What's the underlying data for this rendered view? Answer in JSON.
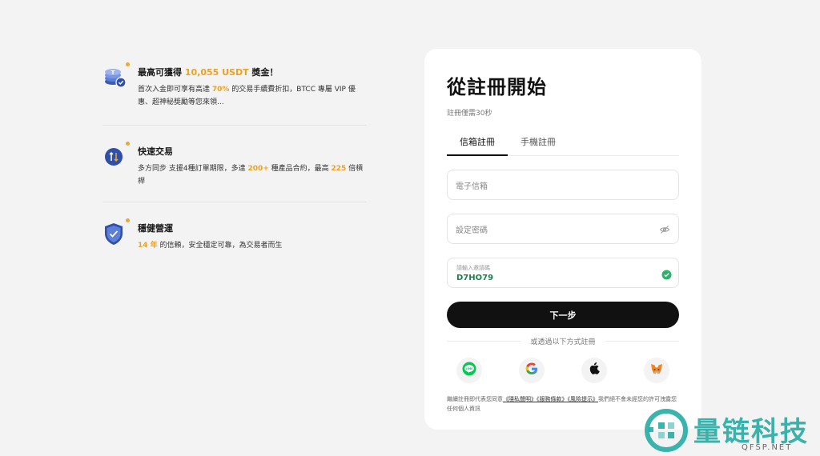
{
  "benefits": [
    {
      "icon": "usdt-coins-icon",
      "title_prefix": "最高可獲得 ",
      "title_highlight": "10,055 USDT",
      "title_suffix": " 獎金！",
      "desc_1": "首次入金即可享有高達 ",
      "desc_hl_1": "70%",
      "desc_2": " 的交易手續費折扣，BTCC 專屬 VIP 優惠、超神秘獎勵等您來領..."
    },
    {
      "icon": "fast-trade-icon",
      "title": "快速交易",
      "desc_1": "多方同步 支援4種訂單期限，多達 ",
      "desc_hl_1": "200+",
      "desc_2": " 種產品合約，最高 ",
      "desc_hl_2": "225",
      "desc_3": " 倍槓桿"
    },
    {
      "icon": "shield-check-icon",
      "title": "穩健營運",
      "desc_hl_1": "14 年",
      "desc_2": " 的信賴，安全穩定可靠，為交易者而生"
    }
  ],
  "card": {
    "title": "從註冊開始",
    "subtitle": "註冊僅需30秒",
    "tabs": [
      "信箱註冊",
      "手機註冊"
    ],
    "email_placeholder": "電子信箱",
    "password_placeholder": "設定密碼",
    "invite_label": "請輸入邀請碼",
    "invite_code": "D7HO79",
    "next_button": "下一步",
    "divider_text": "或透過以下方式註冊",
    "socials": [
      "line-icon",
      "google-icon",
      "apple-icon",
      "metamask-icon"
    ],
    "terms_prefix": "繼續註冊即代表您同意",
    "terms_link_1": "《隱私聲明》",
    "terms_link_2": "《服務條款》",
    "terms_link_3": "《風險提示》",
    "terms_suffix": "我們絕不會未經您的許可洩露您任何個人資訊"
  },
  "watermark": {
    "text": "量链科技",
    "sub": "QFSP.NET"
  },
  "colors": {
    "accent": "#f0a01f",
    "invite_code": "#1a7f4a",
    "button": "#111111",
    "watermark": "#1aa7a0"
  }
}
